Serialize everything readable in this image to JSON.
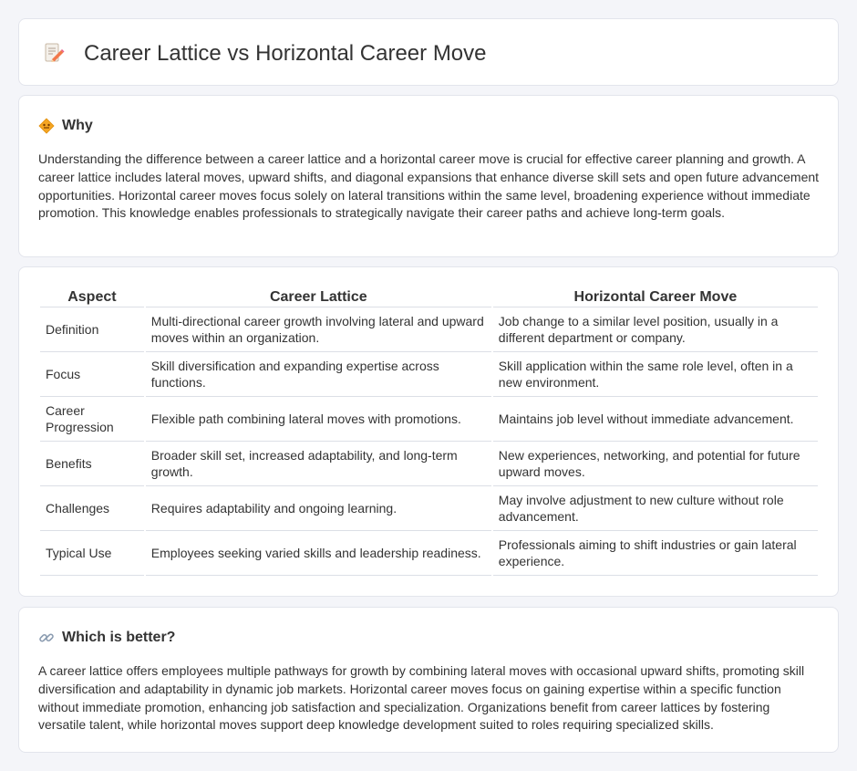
{
  "header": {
    "title": "Career Lattice vs Horizontal Career Move",
    "icon": "memo-pencil-icon"
  },
  "why": {
    "heading": "Why",
    "icon": "diamond-warning-icon",
    "text": "Understanding the difference between a career lattice and a horizontal career move is crucial for effective career planning and growth. A career lattice includes lateral moves, upward shifts, and diagonal expansions that enhance diverse skill sets and open future advancement opportunities. Horizontal career moves focus solely on lateral transitions within the same level, broadening experience without immediate promotion. This knowledge enables professionals to strategically navigate their career paths and achieve long-term goals."
  },
  "table": {
    "headers": [
      "Aspect",
      "Career Lattice",
      "Horizontal Career Move"
    ],
    "rows": [
      [
        "Definition",
        "Multi-directional career growth involving lateral and upward moves within an organization.",
        "Job change to a similar level position, usually in a different department or company."
      ],
      [
        "Focus",
        "Skill diversification and expanding expertise across functions.",
        "Skill application within the same role level, often in a new environment."
      ],
      [
        "Career Progression",
        "Flexible path combining lateral moves with promotions.",
        "Maintains job level without immediate advancement."
      ],
      [
        "Benefits",
        "Broader skill set, increased adaptability, and long-term growth.",
        "New experiences, networking, and potential for future upward moves."
      ],
      [
        "Challenges",
        "Requires adaptability and ongoing learning.",
        "May involve adjustment to new culture without role advancement."
      ],
      [
        "Typical Use",
        "Employees seeking varied skills and leadership readiness.",
        "Professionals aiming to shift industries or gain lateral experience."
      ]
    ]
  },
  "better": {
    "heading": "Which is better?",
    "icon": "link-icon",
    "text": "A career lattice offers employees multiple pathways for growth by combining lateral moves with occasional upward shifts, promoting skill diversification and adaptability in dynamic job markets. Horizontal career moves focus on gaining expertise within a specific function without immediate promotion, enhancing job satisfaction and specialization. Organizations benefit from career lattices by fostering versatile talent, while horizontal moves support deep knowledge development suited to roles requiring specialized skills."
  }
}
